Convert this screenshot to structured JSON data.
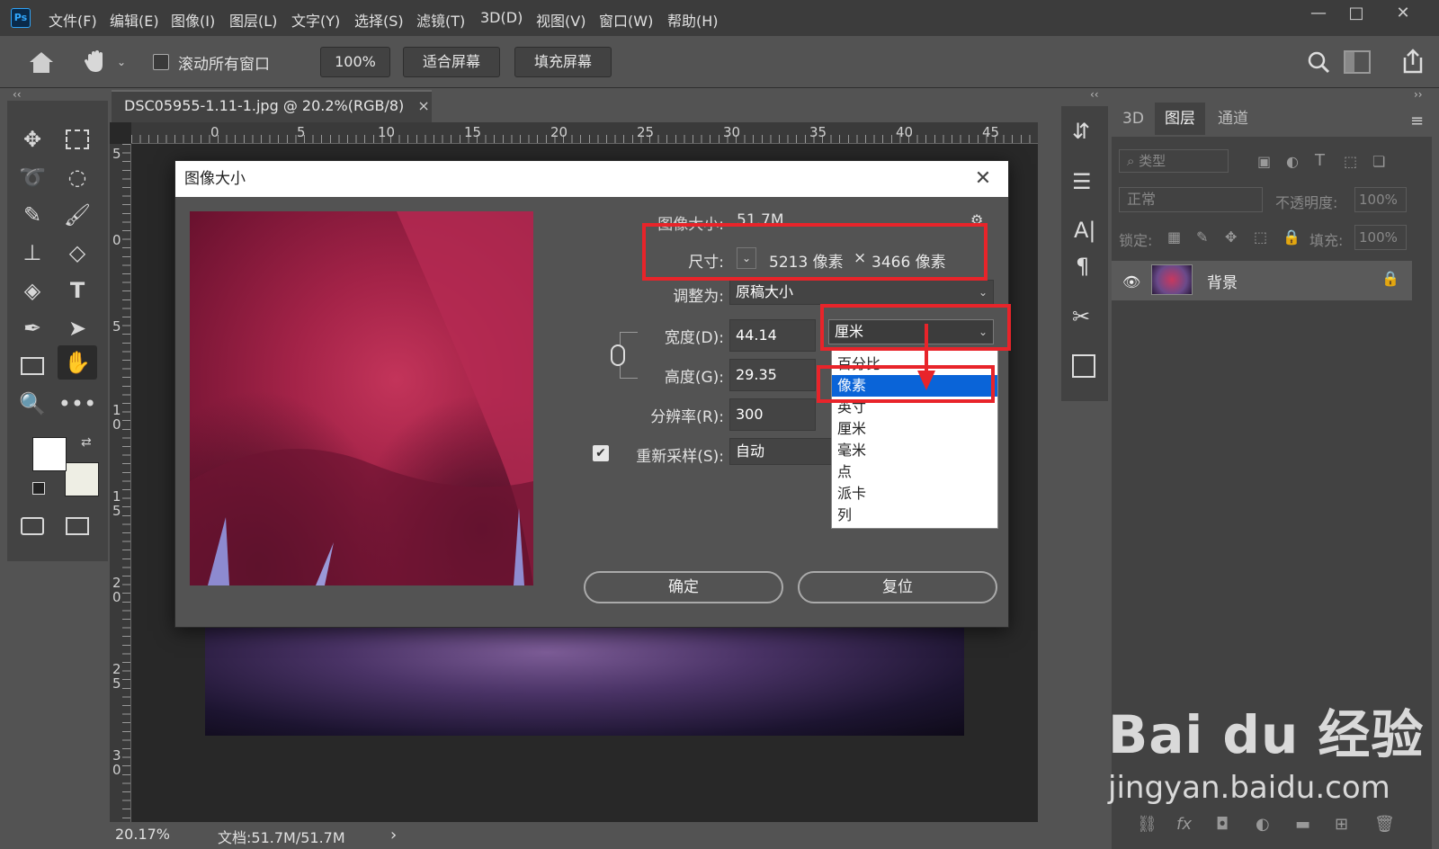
{
  "app": {
    "logo": "Ps",
    "menus": [
      "文件(F)",
      "编辑(E)",
      "图像(I)",
      "图层(L)",
      "文字(Y)",
      "选择(S)",
      "滤镜(T)",
      "3D(D)",
      "视图(V)",
      "窗口(W)",
      "帮助(H)"
    ],
    "window_controls": {
      "min": "—",
      "max": "□",
      "close": "✕"
    }
  },
  "options": {
    "scroll_all_label": "滚动所有窗口",
    "zoom_value": "100%",
    "fit_screen": "适合屏幕",
    "fill_screen": "填充屏幕"
  },
  "document": {
    "tab_title": "DSC05955-1.11-1.jpg @ 20.2%(RGB/8)",
    "tab_close": "×",
    "ruler_h": [
      "0",
      "5",
      "10",
      "15",
      "20",
      "25",
      "30",
      "35",
      "40",
      "45"
    ],
    "ruler_v": [
      "5",
      "0",
      "5",
      "1 0",
      "1 5",
      "2 0",
      "2 5",
      "3 0"
    ]
  },
  "status": {
    "zoom": "20.17%",
    "doc": "文档:51.7M/51.7M",
    "arrow": "›"
  },
  "panel": {
    "tabs": [
      "3D",
      "图层",
      "通道"
    ],
    "filter_placeholder": "类型",
    "blend_mode": "正常",
    "opacity_label": "不透明度:",
    "opacity_value": "100%",
    "lock_label": "锁定:",
    "fill_label": "填充:",
    "fill_value": "100%",
    "layer_name": "背景"
  },
  "dialog": {
    "title": "图像大小",
    "image_size_label": "图像大小:",
    "image_size_value": "51.7M",
    "dimensions_label": "尺寸:",
    "dim_w": "5213 像素",
    "dim_x": "×",
    "dim_h": "3466 像素",
    "fit_label": "调整为:",
    "fit_value": "原稿大小",
    "width_label": "宽度(D):",
    "width_value": "44.14",
    "height_label": "高度(G):",
    "height_value": "29.35",
    "resolution_label": "分辨率(R):",
    "resolution_value": "300",
    "resample_label": "重新采样(S):",
    "resample_value": "自动",
    "unit_selected": "厘米",
    "ok": "确定",
    "reset": "复位",
    "unit_options": [
      "百分比",
      "像素",
      "英寸",
      "厘米",
      "毫米",
      "点",
      "派卡",
      "列"
    ],
    "highlighted_option": "像素"
  },
  "watermark": {
    "brand": "Bai du 经验",
    "url": "jingyan.baidu.com"
  },
  "colors": {
    "highlight_red": "#e8242a",
    "selected_blue": "#0a64d8",
    "ps_blue": "#31a8ff"
  }
}
